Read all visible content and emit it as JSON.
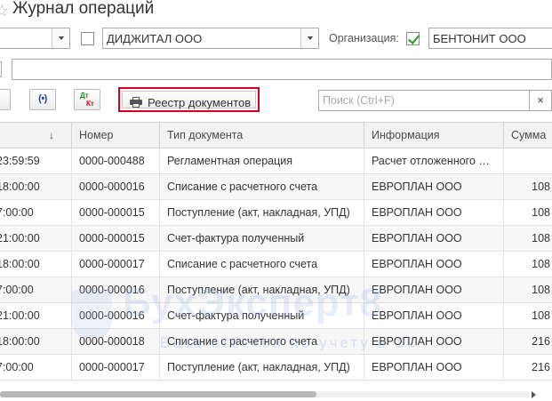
{
  "window": {
    "title": "Журнал операций"
  },
  "filters": {
    "counterparty_value": "ДИДЖИТАЛ ООО",
    "counterparty_checked": false,
    "organization_label": "Организация:",
    "organization_checked": true,
    "organization_value": "БЕНТОНИТ ООО"
  },
  "toolbar": {
    "registry_button_label": "Реестр документов",
    "dt_label": "Дт",
    "kt_label": "Кт",
    "radio_label": "(•)"
  },
  "search": {
    "placeholder": "Поиск (Ctrl+F)",
    "clear_label": "×"
  },
  "table": {
    "columns": [
      "",
      "Номер",
      "Тип документа",
      "Информация",
      "Сумма"
    ],
    "sort_indicator": "↓",
    "rows": [
      {
        "date": "23:59:59",
        "number": "0000-000488",
        "type": "Регламентная операция",
        "info": "Расчет отложенного …",
        "sum": ""
      },
      {
        "date": "18:00:00",
        "number": "0000-000016",
        "type": "Списание с расчетного счета",
        "info": "ЕВРОПЛАН ООО",
        "sum": "108"
      },
      {
        "date": "7:00:00",
        "number": "0000-000015",
        "type": "Поступление (акт, накладная, УПД)",
        "info": "ЕВРОПЛАН ООО",
        "sum": "108"
      },
      {
        "date": "21:00:00",
        "number": "0000-000015",
        "type": "Счет-фактура полученный",
        "info": "ЕВРОПЛАН ООО",
        "sum": "108"
      },
      {
        "date": "18:00:00",
        "number": "0000-000017",
        "type": "Списание с расчетного счета",
        "info": "ЕВРОПЛАН ООО",
        "sum": "108"
      },
      {
        "date": "7:00:00",
        "number": "0000-000016",
        "type": "Поступление (акт, накладная, УПД)",
        "info": "ЕВРОПЛАН ООО",
        "sum": "108"
      },
      {
        "date": "21:00:00",
        "number": "0000-000016",
        "type": "Счет-фактура полученный",
        "info": "ЕВРОПЛАН ООО",
        "sum": "108"
      },
      {
        "date": "18:00:00",
        "number": "0000-000018",
        "type": "Списание с расчетного счета",
        "info": "ЕВРОПЛАН ООО",
        "sum": "216"
      },
      {
        "date": "7:00:00",
        "number": "0000-000017",
        "type": "Поступление (акт, накладная, УПД)",
        "info": "ЕВРОПЛАН ООО",
        "sum": "216"
      }
    ]
  },
  "watermark": {
    "main": "БухЭксперт8",
    "sub": "База ответов по учету в 1С"
  },
  "colors": {
    "highlight": "#d3001b",
    "check": "#1aa31a",
    "header_bg": "#f2f2f2"
  }
}
